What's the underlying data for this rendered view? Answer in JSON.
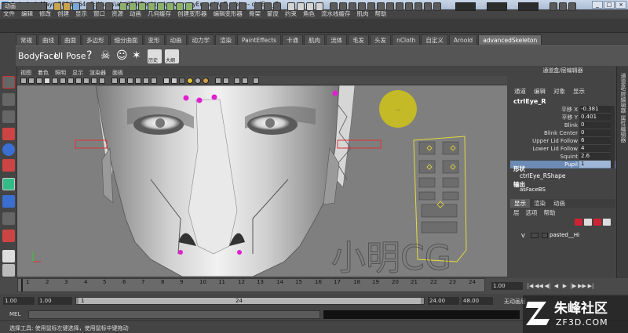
{
  "window": {
    "title": "Autodesk Maya 2013 x64: C:\\Users\\alai628\\Desktop\\adv-angryEunuch\\a7.mb*   ---   ctrlEye_R",
    "controls": [
      "_",
      "□",
      "×"
    ]
  },
  "menubar": [
    "文件",
    "编辑",
    "修改",
    "创建",
    "显示",
    "窗口",
    "资源",
    "动画",
    "几何缓存",
    "创建变形器",
    "编辑变形器",
    "骨架",
    "蒙皮",
    "约束",
    "角色",
    "流水线缓存",
    "肌肉",
    "帮助"
  ],
  "statusline": {
    "mode": "动画",
    "x_label": "X:",
    "y_label": "Y:",
    "z_label": "Z:"
  },
  "shelf_tabs": [
    "常规",
    "曲线",
    "曲面",
    "多边形",
    "细分曲面",
    "变形",
    "动画",
    "动力学",
    "渲染",
    "PaintEffects",
    "卡通",
    "肌肉",
    "流体",
    "毛发",
    "头发",
    "nCloth",
    "自定义",
    "Arnold",
    "advancedSkeleton"
  ],
  "shelf_active": "advancedSkeleton",
  "shelf": {
    "buttons": [
      "Body",
      "Face",
      "UI",
      "Pose"
    ],
    "icons": [
      "?",
      "☠",
      "☺",
      "✶"
    ],
    "history_label": "历史",
    "ar_label": "大纲"
  },
  "viewport": {
    "panel_menu": [
      "视图",
      "着色",
      "照明",
      "显示",
      "渲染器",
      "面板"
    ],
    "frame_numbers": [
      "1",
      "2",
      "3",
      "4",
      "5",
      "6",
      "7",
      "8",
      "9",
      "10",
      "11",
      "12",
      "13",
      "14",
      "15",
      "16",
      "17",
      "18",
      "19",
      "20",
      "21",
      "22",
      "23",
      "24"
    ]
  },
  "watermark": {
    "text": "小明CG",
    "site": "朱峰社区",
    "site_url_text": "ZF3D.COM"
  },
  "channelbox": {
    "title": "通道盒/层编辑器",
    "menu": [
      "通道",
      "编辑",
      "对象",
      "显示"
    ],
    "object": "ctrlEye_R",
    "attributes": [
      {
        "name": "平移 X",
        "value": "-0.381"
      },
      {
        "name": "平移 Y",
        "value": "0.401"
      },
      {
        "name": "Blink",
        "value": "0"
      },
      {
        "name": "Blink Center",
        "value": "0"
      },
      {
        "name": "Upper Lid Follow",
        "value": "6"
      },
      {
        "name": "Lower Lid Follow",
        "value": "4"
      },
      {
        "name": "Squint",
        "value": "2.6"
      },
      {
        "name": "Pupil",
        "value": "1",
        "selected": true
      }
    ],
    "shapes_label": "形状",
    "shape_name": "ctrlEye_RShape",
    "outputs_label": "输出",
    "output_name": "asFaceBS"
  },
  "right_strip": [
    "通道盒/层编辑器",
    "属性编辑器"
  ],
  "layer_editor": {
    "tabs": [
      "显示",
      "渲染",
      "动画"
    ],
    "active_tab": "显示",
    "menu": [
      "层",
      "选项",
      "帮助"
    ],
    "layer": {
      "visible": "V",
      "name": "pasted__Hi"
    }
  },
  "timeslider": {
    "ticks": [
      "1",
      "2",
      "3",
      "4",
      "5",
      "6",
      "7",
      "8",
      "9",
      "10",
      "11",
      "12",
      "13",
      "14",
      "15",
      "16",
      "17",
      "18",
      "19",
      "20",
      "21",
      "22",
      "23",
      "24"
    ],
    "current_frame": "1.00",
    "playback": [
      "|◀",
      "◀◀",
      "◀|",
      "◀",
      "▶",
      "|▶",
      "▶▶",
      "▶|"
    ]
  },
  "rangeslider": {
    "start": "1.00",
    "playback_start": "1.00",
    "handle_start": "1",
    "handle_end": "24",
    "playback_end": "24.00",
    "end": "48.00",
    "char_set": "无动画层"
  },
  "cmdline": {
    "label": "MEL"
  },
  "helpline": {
    "text": "选择工具: 使用鼠标左键选择，使用鼠标中键拖动"
  }
}
